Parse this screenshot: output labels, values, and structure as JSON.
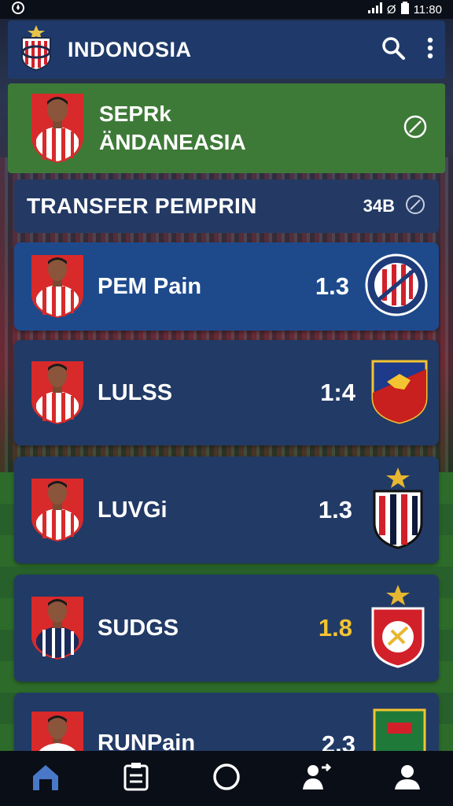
{
  "status_bar": {
    "signal_label": "Ø",
    "time": "11:80"
  },
  "app_bar": {
    "title": "INDONOSIA"
  },
  "hero": {
    "line1": "SEPRk",
    "line2": "ÄNDANEASIA"
  },
  "transfer": {
    "label": "TRANSFER PEMPRIN",
    "count": "34B"
  },
  "players": [
    {
      "name": "PEM Pain",
      "rating": "1.3"
    },
    {
      "name": "LULSS",
      "rating": "1:4"
    },
    {
      "name": "LUVGi",
      "rating": "1.3"
    },
    {
      "name": "SUDGS",
      "rating": "1.8"
    },
    {
      "name": "RUNPain",
      "rating": "2.3"
    }
  ],
  "colors": {
    "appbar": "#1f3a6a",
    "hero": "#3e7a37",
    "card": "#223a66",
    "active_card": "#1e4a8c",
    "gold": "#f3c431"
  },
  "icons": {
    "search": "search-icon",
    "menu": "more-vert-icon",
    "hero_action": "slash-circle-icon",
    "nav": [
      "stadium-icon",
      "clipboard-icon",
      "circle-icon",
      "transfer-icon",
      "profile-icon"
    ]
  }
}
